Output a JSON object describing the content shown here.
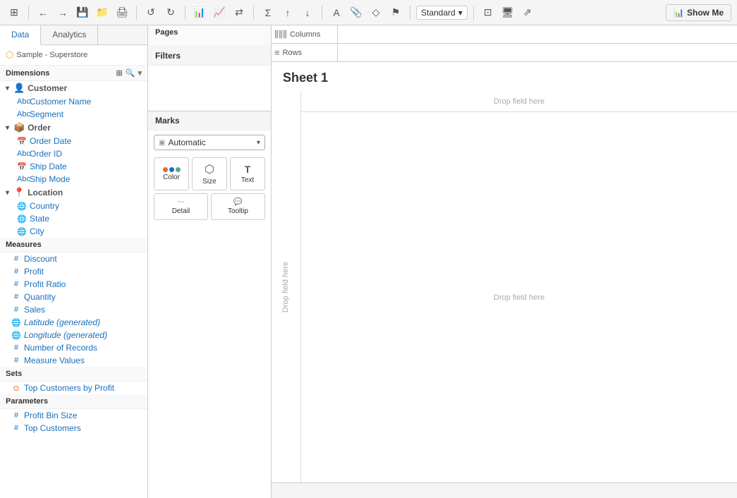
{
  "toolbar": {
    "standard_label": "Standard",
    "show_me_label": "Show Me"
  },
  "left_panel": {
    "tab_data": "Data",
    "tab_analytics": "Analytics",
    "data_source": "Sample - Superstore",
    "dimensions_label": "Dimensions",
    "measures_label": "Measures",
    "sets_label": "Sets",
    "parameters_label": "Parameters",
    "dimensions": {
      "customer_group": "Customer",
      "customer_name": "Customer Name",
      "segment": "Segment",
      "order_group": "Order",
      "order_date": "Order Date",
      "order_id": "Order ID",
      "ship_date": "Ship Date",
      "ship_mode": "Ship Mode",
      "location_group": "Location",
      "country": "Country",
      "state": "State",
      "city": "City"
    },
    "measures": {
      "discount": "Discount",
      "profit": "Profit",
      "profit_ratio": "Profit Ratio",
      "quantity": "Quantity",
      "sales": "Sales",
      "latitude": "Latitude (generated)",
      "longitude": "Longitude (generated)",
      "number_of_records": "Number of Records",
      "measure_values": "Measure Values"
    },
    "sets": {
      "top_customers": "Top Customers by Profit"
    },
    "parameters": {
      "profit_bin_size": "Profit Bin Size",
      "top_customers": "Top Customers"
    }
  },
  "middle_panel": {
    "filters_label": "Filters",
    "marks_label": "Marks",
    "marks_type": "Automatic",
    "marks_buttons": {
      "color": "Color",
      "size": "Size",
      "text": "Text",
      "detail": "Detail",
      "tooltip": "Tooltip"
    }
  },
  "shelves": {
    "pages_label": "Pages",
    "columns_label": "Columns",
    "rows_label": "Rows"
  },
  "sheet": {
    "title": "Sheet 1",
    "drop_field_here_top": "Drop field here",
    "drop_field_here_left": "Drop field here",
    "drop_field_here_center": "Drop field here"
  },
  "status_bar": {
    "text": ""
  }
}
